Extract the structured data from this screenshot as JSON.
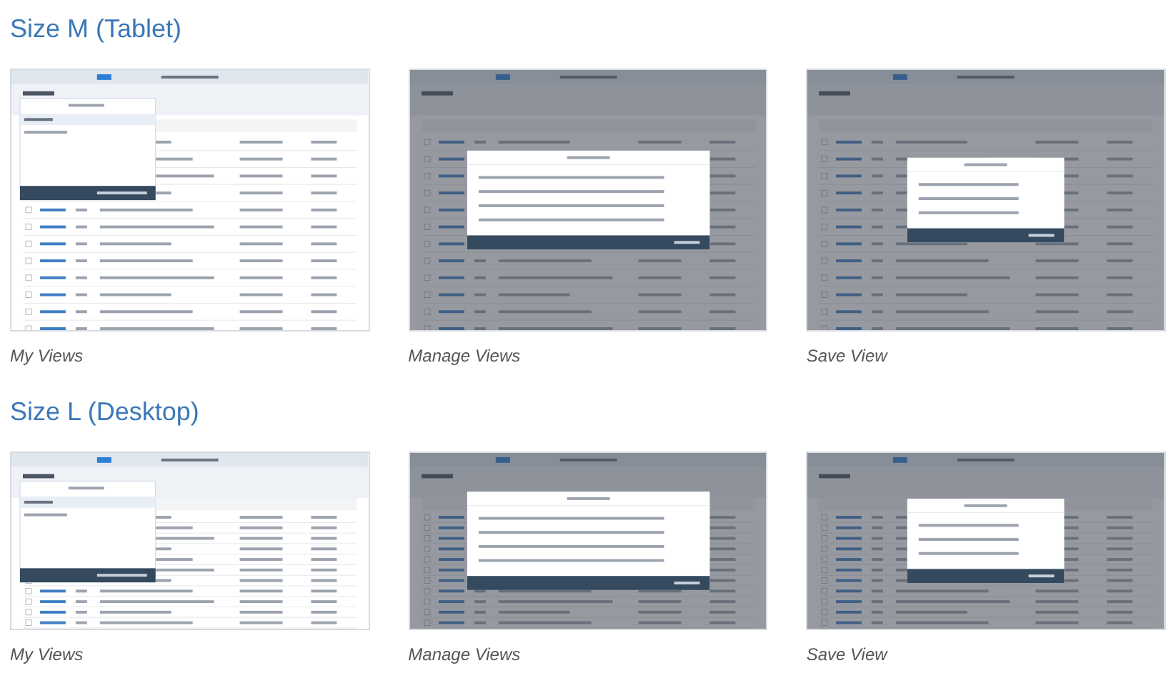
{
  "sections": [
    {
      "title": "Size M (Tablet)",
      "kind": "tablet",
      "items": [
        {
          "caption": "My Views",
          "kind": "my_views"
        },
        {
          "caption": "Manage Views",
          "kind": "manage_views"
        },
        {
          "caption": "Save View",
          "kind": "save_view"
        }
      ]
    },
    {
      "title": "Size L (Desktop)",
      "kind": "desktop",
      "items": [
        {
          "caption": "My Views",
          "kind": "my_views"
        },
        {
          "caption": "Manage Views",
          "kind": "manage_views"
        },
        {
          "caption": "Save View",
          "kind": "save_view"
        }
      ]
    }
  ]
}
